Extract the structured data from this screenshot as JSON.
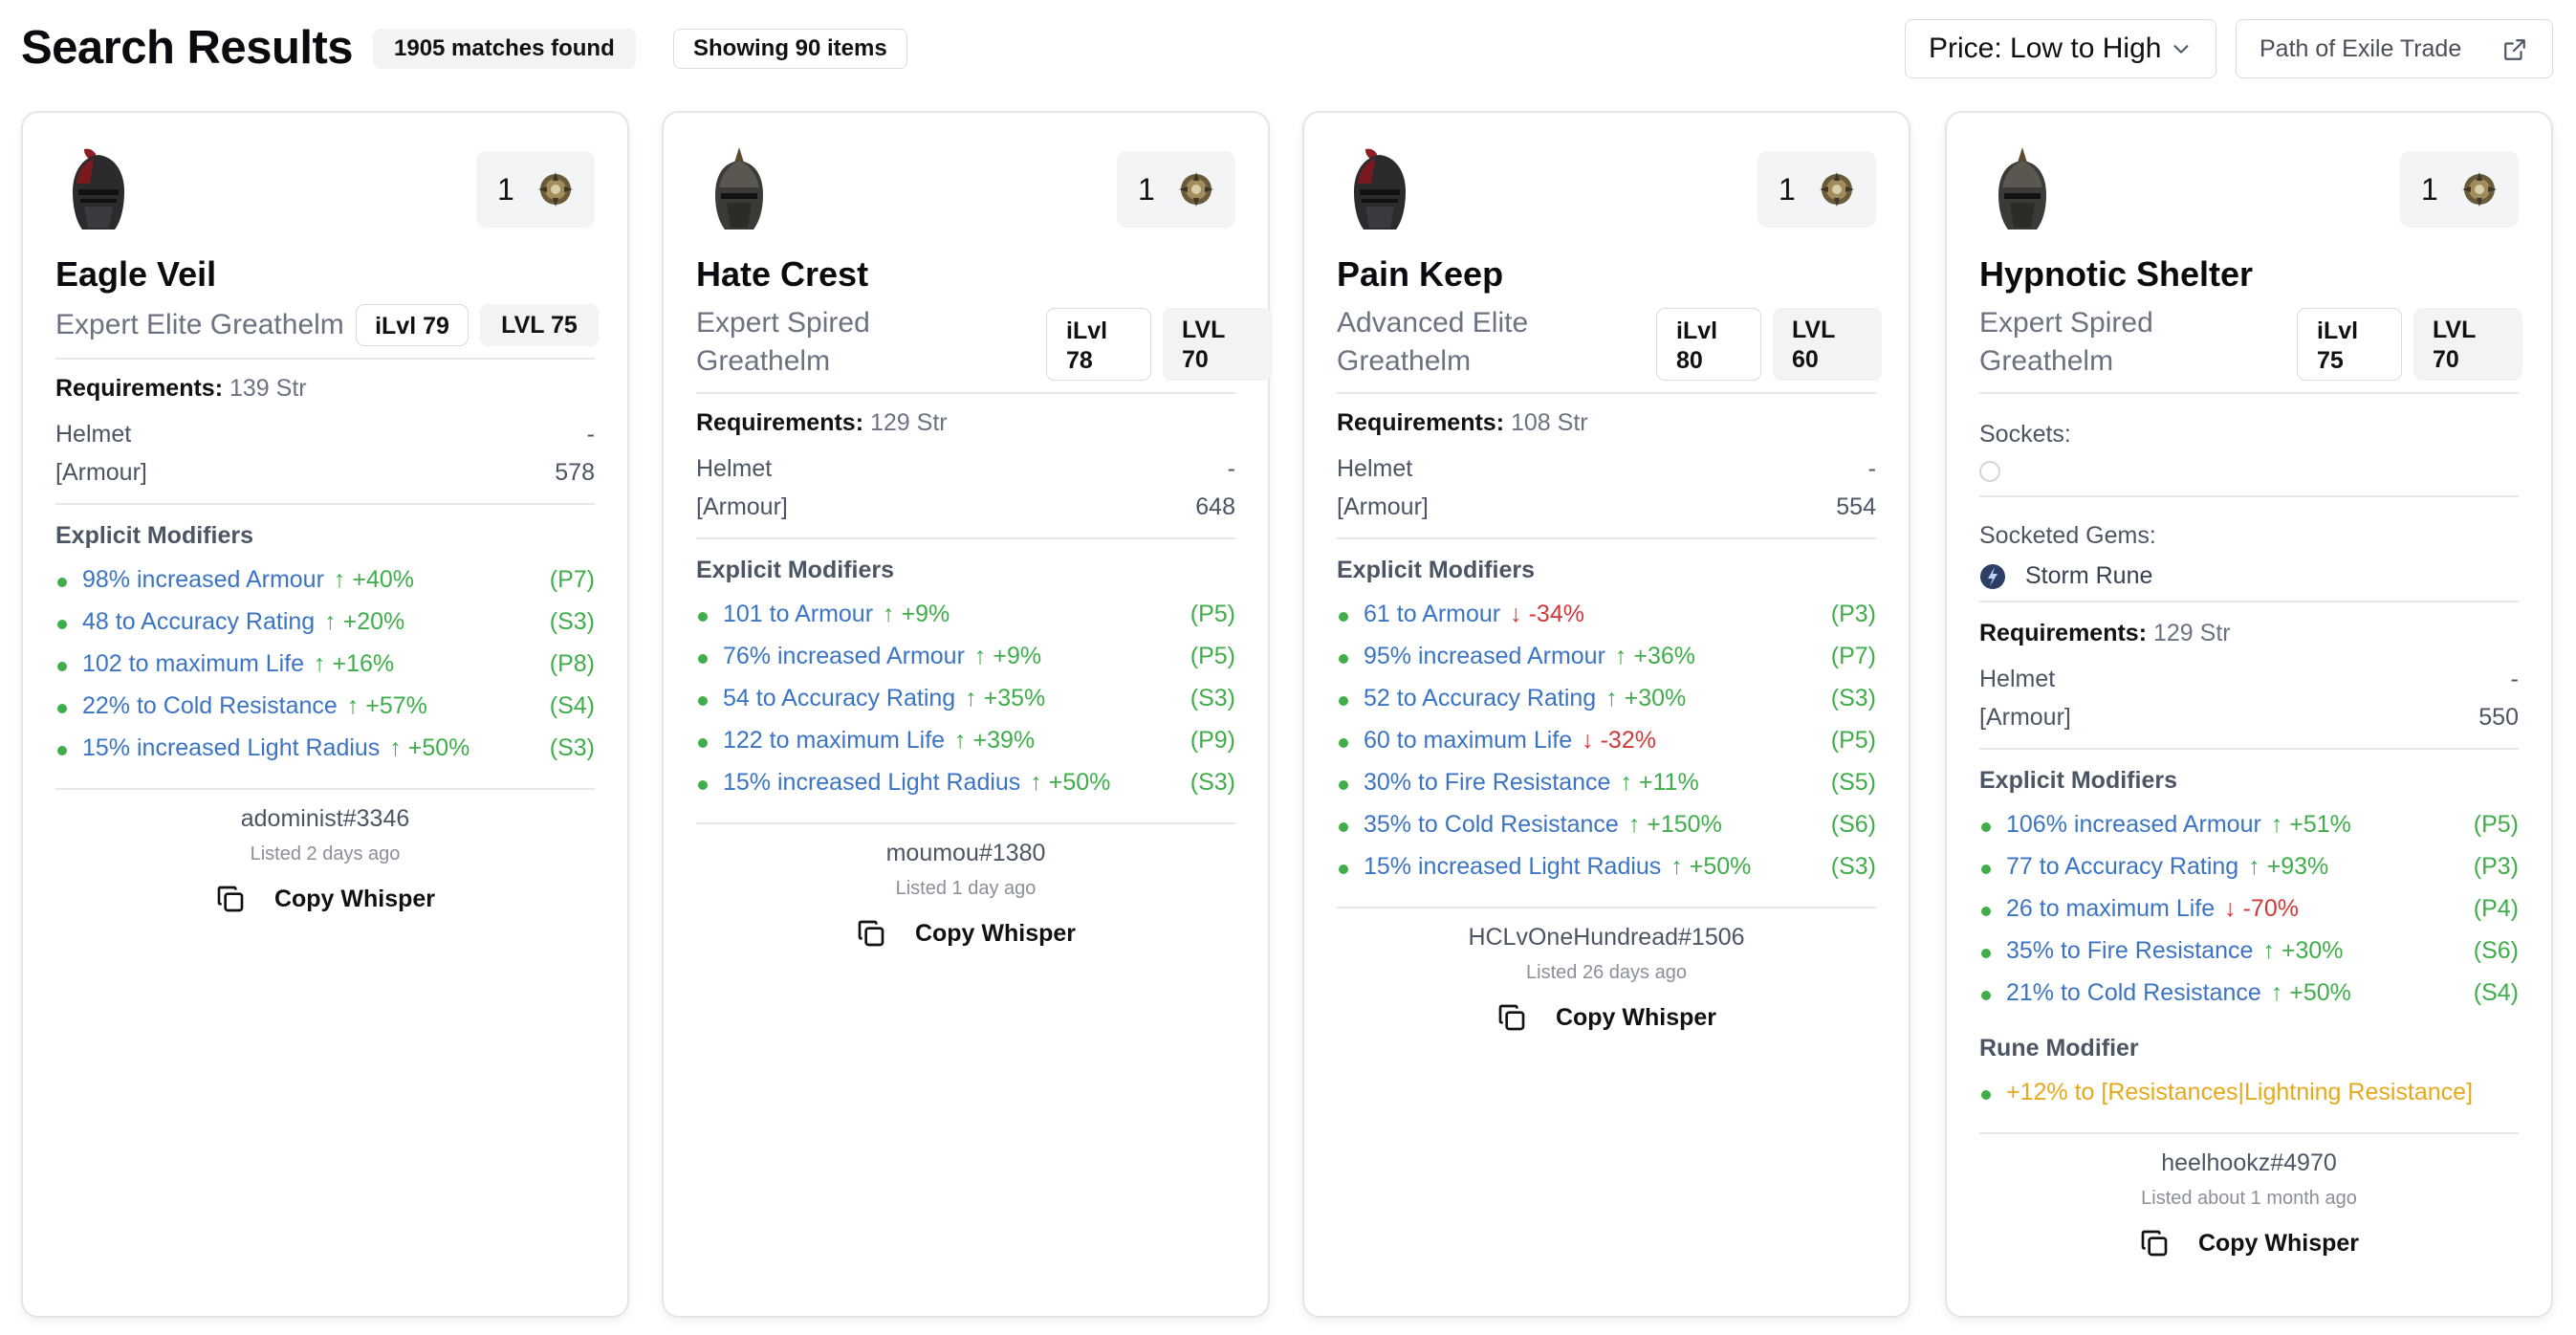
{
  "header": {
    "title": "Search Results",
    "matches_badge": "1905 matches found",
    "showing_badge": "Showing 90 items",
    "sort_label": "Price: Low to High",
    "trade_link": "Path of Exile Trade"
  },
  "colors": {
    "mod_text": "#3b74c4",
    "mod_up": "#3fae4a",
    "mod_down": "#d2383a",
    "rune": "#e6a91e"
  },
  "cards": [
    {
      "name": "Eagle Veil",
      "base": [
        "Expert Elite Greathelm"
      ],
      "ilvl": "iLvl 79",
      "lvl": "LVL 75",
      "price_qty": "1",
      "requirements_label": "Requirements:",
      "requirements_value": "139 Str",
      "type_label": "Helmet",
      "type_value": "-",
      "armour_label": "[Armour]",
      "armour_value": "578",
      "explicit_title": "Explicit Modifiers",
      "mods": [
        {
          "text": "98% increased Armour",
          "change": "↑ +40%",
          "dir": "up",
          "tier": "(P7)"
        },
        {
          "text": "48 to Accuracy Rating",
          "change": "↑ +20%",
          "dir": "up",
          "tier": "(S3)"
        },
        {
          "text": "102 to maximum Life",
          "change": "↑ +16%",
          "dir": "up",
          "tier": "(P8)"
        },
        {
          "text": "22% to Cold Resistance",
          "change": "↑ +57%",
          "dir": "up",
          "tier": "(S4)"
        },
        {
          "text": "15% increased Light Radius",
          "change": "↑ +50%",
          "dir": "up",
          "tier": "(S3)"
        }
      ],
      "seller": "adominist#3346",
      "listed": "Listed 2 days ago",
      "copy_label": "Copy Whisper"
    },
    {
      "name": "Hate Crest",
      "base": [
        "Expert Spired",
        "Greathelm"
      ],
      "ilvl": [
        "iLvl",
        "78"
      ],
      "lvl": [
        "LVL",
        "70"
      ],
      "price_qty": "1",
      "requirements_label": "Requirements:",
      "requirements_value": "129 Str",
      "type_label": "Helmet",
      "type_value": "-",
      "armour_label": "[Armour]",
      "armour_value": "648",
      "explicit_title": "Explicit Modifiers",
      "mods": [
        {
          "text": "101 to Armour",
          "change": "↑ +9%",
          "dir": "up",
          "tier": "(P5)"
        },
        {
          "text": "76% increased Armour",
          "change": "↑ +9%",
          "dir": "up",
          "tier": "(P5)"
        },
        {
          "text": "54 to Accuracy Rating",
          "change": "↑ +35%",
          "dir": "up",
          "tier": "(S3)"
        },
        {
          "text": "122 to maximum Life",
          "change": "↑ +39%",
          "dir": "up",
          "tier": "(P9)"
        },
        {
          "text": "15% increased Light Radius",
          "change": "↑ +50%",
          "dir": "up",
          "tier": "(S3)"
        }
      ],
      "seller": "moumou#1380",
      "listed": "Listed 1 day ago",
      "copy_label": "Copy Whisper"
    },
    {
      "name": "Pain Keep",
      "base": [
        "Advanced Elite",
        "Greathelm"
      ],
      "ilvl": [
        "iLvl",
        "80"
      ],
      "lvl": [
        "LVL",
        "60"
      ],
      "price_qty": "1",
      "requirements_label": "Requirements:",
      "requirements_value": "108 Str",
      "type_label": "Helmet",
      "type_value": "-",
      "armour_label": "[Armour]",
      "armour_value": "554",
      "explicit_title": "Explicit Modifiers",
      "mods": [
        {
          "text": "61 to Armour",
          "change": "↓ -34%",
          "dir": "down",
          "tier": "(P3)"
        },
        {
          "text": "95% increased Armour",
          "change": "↑ +36%",
          "dir": "up",
          "tier": "(P7)"
        },
        {
          "text": "52 to Accuracy Rating",
          "change": "↑ +30%",
          "dir": "up",
          "tier": "(S3)"
        },
        {
          "text": "60 to maximum Life",
          "change": "↓ -32%",
          "dir": "down",
          "tier": "(P5)"
        },
        {
          "text": "30% to Fire Resistance",
          "change": "↑ +11%",
          "dir": "up",
          "tier": "(S5)"
        },
        {
          "text": "35% to Cold Resistance",
          "change": "↑ +150%",
          "dir": "up",
          "tier": "(S6)"
        },
        {
          "text": "15% increased Light Radius",
          "change": "↑ +50%",
          "dir": "up",
          "tier": "(S3)"
        }
      ],
      "seller": "HCLvOneHundread#1506",
      "listed": "Listed 26 days ago",
      "copy_label": "Copy Whisper"
    },
    {
      "name": "Hypnotic Shelter",
      "base": [
        "Expert Spired",
        "Greathelm"
      ],
      "ilvl": [
        "iLvl",
        "75"
      ],
      "lvl": [
        "LVL",
        "70"
      ],
      "price_qty": "1",
      "sockets_label": "Sockets:",
      "socketed_gems_label": "Socketed Gems:",
      "gem_name": "Storm Rune",
      "requirements_label": "Requirements:",
      "requirements_value": "129 Str",
      "type_label": "Helmet",
      "type_value": "-",
      "armour_label": "[Armour]",
      "armour_value": "550",
      "explicit_title": "Explicit Modifiers",
      "mods": [
        {
          "text": "106% increased Armour",
          "change": "↑ +51%",
          "dir": "up",
          "tier": "(P5)"
        },
        {
          "text": "77 to Accuracy Rating",
          "change": "↑ +93%",
          "dir": "up",
          "tier": "(P3)"
        },
        {
          "text": "26 to maximum Life",
          "change": "↓ -70%",
          "dir": "down",
          "tier": "(P4)"
        },
        {
          "text": "35% to Fire Resistance",
          "change": "↑ +30%",
          "dir": "up",
          "tier": "(S6)"
        },
        {
          "text": "21% to Cold Resistance",
          "change": "↑ +50%",
          "dir": "up",
          "tier": "(S4)"
        }
      ],
      "rune_title": "Rune Modifier",
      "rune_mod": "+12% to [Resistances|Lightning Resistance]",
      "seller": "heelhookz#4970",
      "listed": "Listed about 1 month ago",
      "copy_label": "Copy Whisper"
    }
  ]
}
